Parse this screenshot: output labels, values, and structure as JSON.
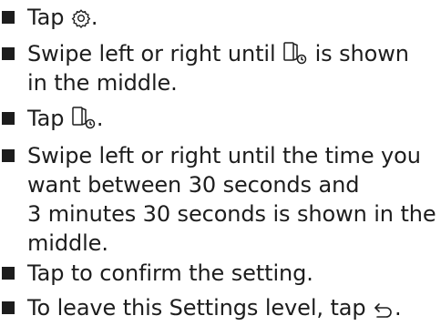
{
  "steps": [
    {
      "lines": [
        "Tap",
        "."
      ]
    },
    {
      "lines": [
        "Swipe left or right until",
        "is shown",
        "in the middle."
      ]
    },
    {
      "lines": [
        "Tap",
        "."
      ]
    },
    {
      "lines": [
        "Swipe left or right until the time you",
        "want between 30 seconds and",
        "3 minutes 30 seconds is shown in the",
        "middle."
      ]
    },
    {
      "lines": [
        "Tap to confirm the setting."
      ]
    },
    {
      "lines": [
        "To leave this Settings level, tap",
        "."
      ]
    }
  ],
  "icons": {
    "gear": "gear-icon",
    "door_timer": "door-timer-icon",
    "back": "back-arrow-icon"
  },
  "colors": {
    "text": "#1d1d1d",
    "background": "#ffffff"
  }
}
